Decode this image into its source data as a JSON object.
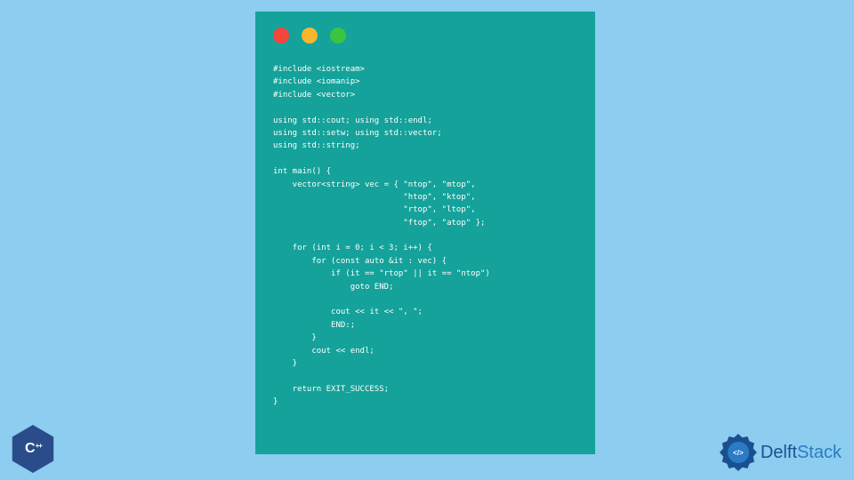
{
  "code": {
    "line1": "#include <iostream>",
    "line2": "#include <iomanip>",
    "line3": "#include <vector>",
    "blank1": "",
    "line4": "using std::cout; using std::endl;",
    "line5": "using std::setw; using std::vector;",
    "line6": "using std::string;",
    "blank2": "",
    "line7": "int main() {",
    "line8": "    vector<string> vec = { \"ntop\", \"mtop\",",
    "line9": "                           \"htop\", \"ktop\",",
    "line10": "                           \"rtop\", \"ltop\",",
    "line11": "                           \"ftop\", \"atop\" };",
    "blank3": "",
    "line12": "    for (int i = 0; i < 3; i++) {",
    "line13": "        for (const auto &it : vec) {",
    "line14": "            if (it == \"rtop\" || it == \"ntop\")",
    "line15": "                goto END;",
    "blank4": "",
    "line16": "            cout << it << \", \";",
    "line17": "            END:;",
    "line18": "        }",
    "line19": "        cout << endl;",
    "line20": "    }",
    "blank5": "",
    "line21": "    return EXIT_SUCCESS;",
    "line22": "}"
  },
  "logos": {
    "cpp": {
      "letter": "C",
      "plus": "++"
    },
    "delft": {
      "badge_inner": "</>",
      "name_first": "Delft",
      "name_second": "Stack"
    }
  }
}
